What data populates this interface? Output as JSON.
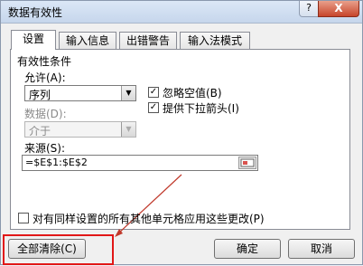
{
  "window": {
    "title": "数据有效性",
    "help_label": "?",
    "close_label": "X"
  },
  "tabs": [
    {
      "label": "设置",
      "active": true
    },
    {
      "label": "输入信息",
      "active": false
    },
    {
      "label": "出错警告",
      "active": false
    },
    {
      "label": "输入法模式",
      "active": false
    }
  ],
  "settings": {
    "group_title": "有效性条件",
    "allow_label": "允许(A):",
    "allow_value": "序列",
    "data_label": "数据(D):",
    "data_value": "介于",
    "ignore_blank_label": "忽略空值(B)",
    "ignore_blank_checked": true,
    "dropdown_label": "提供下拉箭头(I)",
    "dropdown_checked": true,
    "source_label": "来源(S):",
    "source_value": "=$E$1:$E$2",
    "apply_all_label": "对有同样设置的所有其他单元格应用这些更改(P)",
    "apply_all_checked": false
  },
  "buttons": {
    "clear_all": "全部清除(C)",
    "ok": "确定",
    "cancel": "取消"
  },
  "colors": {
    "highlight": "#e11717",
    "arrow": "#c0392b"
  }
}
